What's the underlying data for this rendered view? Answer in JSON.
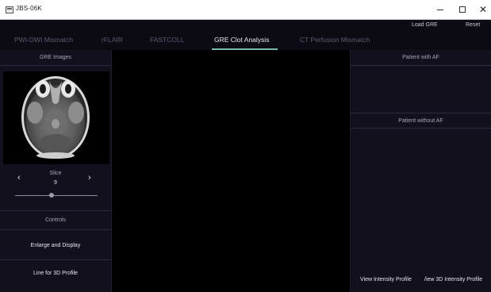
{
  "window": {
    "title": "JBS-06K"
  },
  "toolbar": {
    "load_gre": "Load GRE",
    "reset": "Reset"
  },
  "tabs": [
    {
      "label": "PWI-DWI Mismatch",
      "active": false
    },
    {
      "label": "rFLAIR",
      "active": false
    },
    {
      "label": "FASTCOLL",
      "active": false
    },
    {
      "label": "GRE Clot Analysis",
      "active": true
    },
    {
      "label": "CT Perfusion Mismatch",
      "active": false
    }
  ],
  "left_panel": {
    "header": "GRE Images",
    "slice_label": "Slice",
    "slice_value": "9",
    "slice_level": 0.44,
    "controls_header": "Controls",
    "buttons": [
      "Enlarge and Display",
      "Line for 3D Profile"
    ]
  },
  "right_panel": {
    "patient_af": "Patient with AF",
    "patient_no_af": "Patient without AF",
    "buttons": [
      "View Intensity Profile",
      "/iew 3D Intensity Profile"
    ]
  },
  "colors": {
    "accent": "#7ab8b0",
    "background": "#0c0b14",
    "panel": "#11101c"
  },
  "icons": {
    "prev_slice": "chevron-left-icon",
    "next_slice": "chevron-right-icon"
  }
}
